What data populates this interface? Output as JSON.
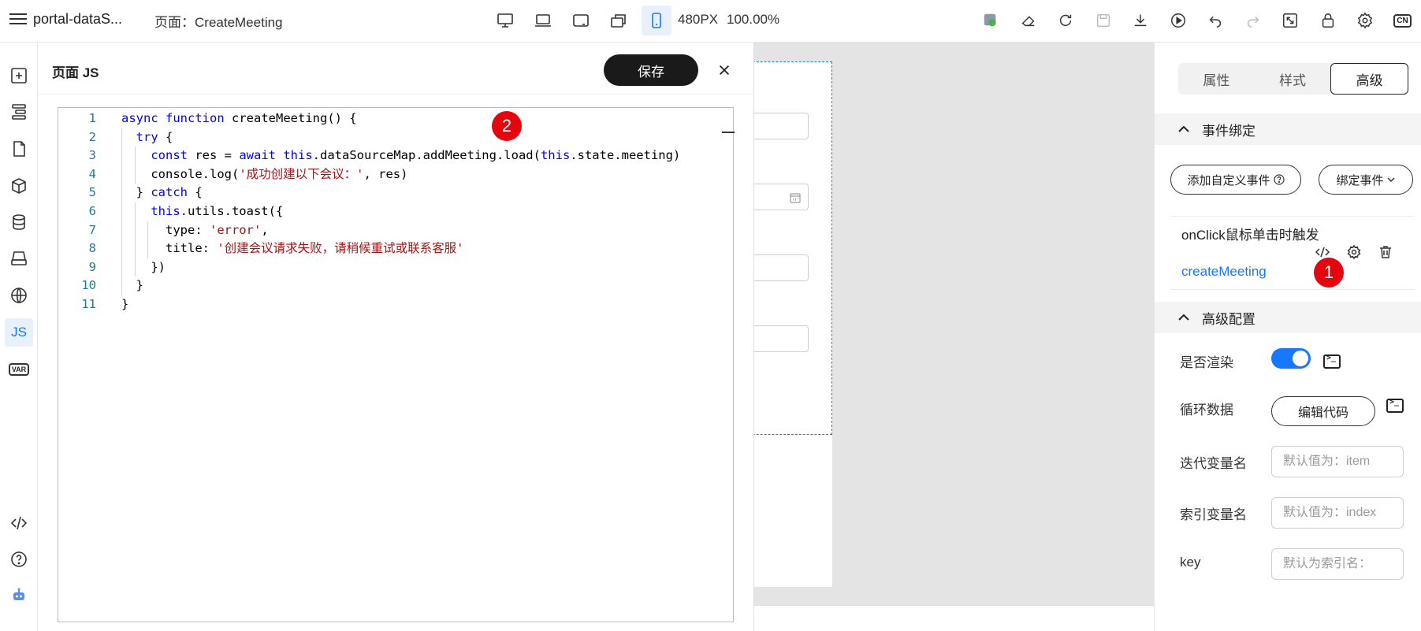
{
  "header": {
    "app_title": "portal-dataS...",
    "page_label": "页面：CreateMeeting",
    "size": "480PX",
    "zoom": "100.00%",
    "lang": "CN"
  },
  "leftbar": {
    "js_label": "JS",
    "var_label": "VAR"
  },
  "js_panel": {
    "title": "页面 JS",
    "save_label": "保存",
    "lines": [
      {
        "num": "1",
        "segments": [
          {
            "t": "async",
            "c": "kw"
          },
          {
            "t": " "
          },
          {
            "t": "function",
            "c": "kw"
          },
          {
            "t": " createMeeting() {"
          }
        ]
      },
      {
        "num": "2",
        "segments": [
          {
            "t": "  "
          },
          {
            "t": "try",
            "c": "kw"
          },
          {
            "t": " {"
          }
        ]
      },
      {
        "num": "3",
        "segments": [
          {
            "t": "    "
          },
          {
            "t": "const",
            "c": "kw"
          },
          {
            "t": " res = "
          },
          {
            "t": "await",
            "c": "kw"
          },
          {
            "t": " "
          },
          {
            "t": "this",
            "c": "kw"
          },
          {
            "t": ".dataSourceMap.addMeeting.load("
          },
          {
            "t": "this",
            "c": "kw"
          },
          {
            "t": ".state.meeting)"
          }
        ]
      },
      {
        "num": "4",
        "segments": [
          {
            "t": "    console.log("
          },
          {
            "t": "'成功创建以下会议：'",
            "c": "str"
          },
          {
            "t": ", res)"
          }
        ]
      },
      {
        "num": "5",
        "segments": [
          {
            "t": "  } "
          },
          {
            "t": "catch",
            "c": "kw"
          },
          {
            "t": " {"
          }
        ]
      },
      {
        "num": "6",
        "segments": [
          {
            "t": "    "
          },
          {
            "t": "this",
            "c": "kw"
          },
          {
            "t": ".utils.toast({"
          }
        ]
      },
      {
        "num": "7",
        "segments": [
          {
            "t": "      type: "
          },
          {
            "t": "'error'",
            "c": "str"
          },
          {
            "t": ","
          }
        ]
      },
      {
        "num": "8",
        "segments": [
          {
            "t": "      title: "
          },
          {
            "t": "'创建会议请求失败，请稍候重试或联系客服'",
            "c": "str"
          }
        ]
      },
      {
        "num": "9",
        "segments": [
          {
            "t": "    })"
          }
        ]
      },
      {
        "num": "10",
        "segments": [
          {
            "t": "  }"
          }
        ]
      },
      {
        "num": "11",
        "segments": [
          {
            "t": "}"
          }
        ]
      }
    ]
  },
  "badges": {
    "one": "1",
    "two": "2"
  },
  "right_panel": {
    "tabs": [
      "属性",
      "样式",
      "高级"
    ],
    "active_tab": 2,
    "event_section": "事件绑定",
    "add_custom_event": "添加自定义事件",
    "bind_event": "绑定事件",
    "event": {
      "desc": "onClick鼠标单击时触发",
      "handler": "createMeeting"
    },
    "advanced_section": "高级配置",
    "render_label": "是否渲染",
    "render_on": true,
    "loop_label": "循环数据",
    "edit_code": "编辑代码",
    "iter_label": "迭代变量名",
    "iter_placeholder": "默认值为：item",
    "index_label": "索引变量名",
    "index_placeholder": "默认值为：index",
    "key_label": "key",
    "key_placeholder": "默认为索引名："
  }
}
